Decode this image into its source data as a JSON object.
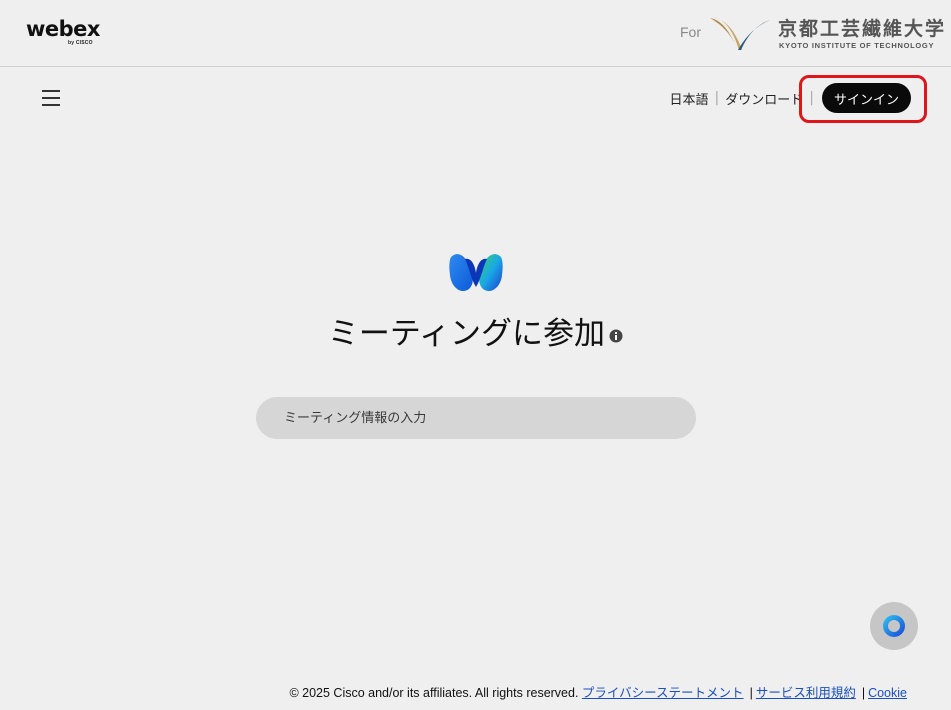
{
  "header": {
    "brand": "webex",
    "brand_sub": "by CISCO",
    "for_label": "For",
    "partner_name": "京都工芸繊維大学",
    "partner_sub": "KYOTO INSTITUTE OF TECHNOLOGY"
  },
  "topnav": {
    "language": "日本語",
    "download": "ダウンロード",
    "signin": "サインイン"
  },
  "main": {
    "title": "ミーティングに参加",
    "input_placeholder": "ミーティング情報の入力",
    "input_value": ""
  },
  "footer": {
    "copyright": "© 2025 Cisco and/or its affiliates. All rights reserved.",
    "privacy": "プライバシーステートメント",
    "terms": "サービス利用規約",
    "cookie": "Cookie"
  },
  "icons": {
    "menu": "hamburger-menu-icon",
    "logo": "webex-logo-icon",
    "info": "info-icon",
    "help": "webex-assistant-icon",
    "partner_mark": "kit-logo-mark"
  },
  "colors": {
    "background": "#efefef",
    "signin_bg": "#0a0a0a",
    "highlight": "#e0141b",
    "link": "#1a4fc2",
    "input_bg": "#d6d6d6"
  }
}
